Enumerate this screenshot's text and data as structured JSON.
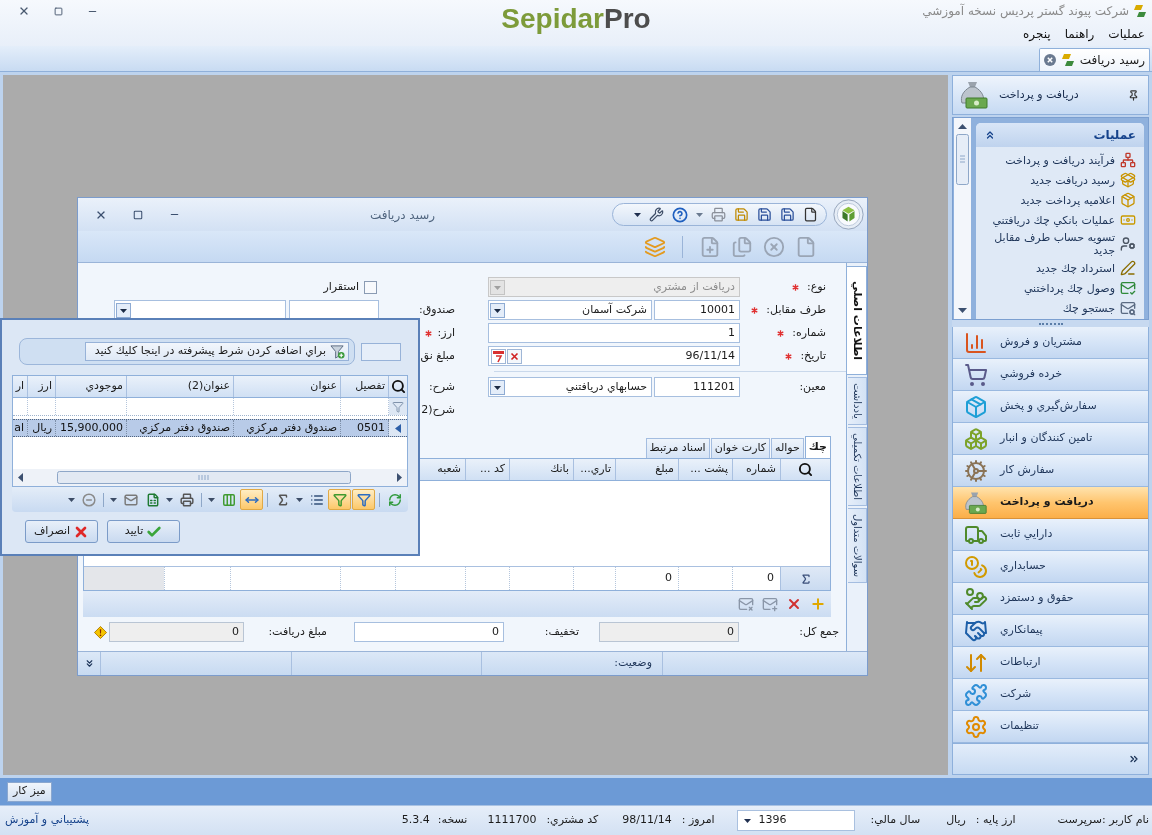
{
  "window": {
    "title": "شرکت پيوند گستر پرديس نسخه آموزشي",
    "logo": {
      "text_1": "Sepidar",
      "text_2": "Pro"
    }
  },
  "menu": [
    "عمليات",
    "راهنما",
    "پنجره"
  ],
  "document_tabs": [
    {
      "label": "رسيد دريافت",
      "selected": true
    }
  ],
  "sidebar": {
    "header": {
      "title": "دريافت و پرداخت"
    },
    "task_group": {
      "title": "عمليات",
      "expanded": true,
      "items": [
        "فرآيند دريافت و پرداخت",
        "رسيد دريافت جديد",
        "اعلاميه پرداخت جديد",
        "عمليات بانکي چك دريافتني",
        "تسويه حساب طرف مقابل جديد",
        "استرداد چك جديد",
        "وصول چك پرداختني",
        "جستجو چك"
      ]
    },
    "nav_items": [
      {
        "label": "مشتريان و فروش",
        "selected": false
      },
      {
        "label": "خرده فروشي",
        "selected": false
      },
      {
        "label": "سفارش‌گيري و پخش",
        "selected": false
      },
      {
        "label": "تامين کنندگان و انبار",
        "selected": false
      },
      {
        "label": "سفارش کار",
        "selected": false
      },
      {
        "label": "دريافت و پرداخت",
        "selected": true
      },
      {
        "label": "دارايي ثابت",
        "selected": false
      },
      {
        "label": "حسابداري",
        "selected": false
      },
      {
        "label": "حقوق و دستمزد",
        "selected": false
      },
      {
        "label": "پيمانکاري",
        "selected": false
      },
      {
        "label": "ارتباطات",
        "selected": false
      },
      {
        "label": "شرکت",
        "selected": false
      },
      {
        "label": "تنظيمات",
        "selected": false
      }
    ]
  },
  "receipt_window": {
    "title": "رسيد دريافت",
    "side_tabs": [
      {
        "label": "اطلاعات اصلي",
        "selected": true
      },
      {
        "label": "يادداشت",
        "selected": false
      },
      {
        "label": "اطلاعات تکميلي",
        "selected": false
      },
      {
        "label": "سوالات متداول",
        "selected": false
      }
    ],
    "fields": [
      {
        "kind": "combo",
        "label": "نوع:",
        "required": true,
        "disabled": true,
        "value": "دريافت از مشتري"
      },
      {
        "kind": "code_combo",
        "label": "طرف مقابل:",
        "required": true,
        "disabled": false,
        "code": "10001",
        "value": "شرکت آسمان"
      },
      {
        "kind": "text",
        "label": "شماره:",
        "required": true,
        "disabled": false,
        "value": "1"
      },
      {
        "kind": "date",
        "label": "تاريخ:",
        "required": true,
        "disabled": false,
        "value": "96/11/14"
      },
      {
        "kind": "code_combo",
        "label": "معين:",
        "required": false,
        "disabled": false,
        "code": "111201",
        "value": "حسابهاي دريافتني"
      }
    ],
    "side_fields": [
      {
        "kind": "checkbox",
        "label": "استقرار",
        "checked": false,
        "required": false
      },
      {
        "kind": "code_combo",
        "label": "صندوق:",
        "required": false
      },
      {
        "kind": "label",
        "label": "ارز:",
        "required": true
      },
      {
        "kind": "label",
        "label": "مبلغ نق",
        "required": false
      },
      {
        "kind": "label",
        "label": "شرح:",
        "required": false
      },
      {
        "kind": "label",
        "label": "شرح(2",
        "required": false
      }
    ],
    "detail_tabs": [
      {
        "label": "چك",
        "selected": true
      },
      {
        "label": "حواله",
        "selected": false
      },
      {
        "label": "کارت خوان",
        "selected": false
      },
      {
        "label": "اسناد مرتبط",
        "selected": false
      }
    ],
    "cheque_grid": {
      "columns": [
        {
          "label": "شماره",
          "total": "0"
        },
        {
          "label": "پشت ..."
        },
        {
          "label": "مبلغ",
          "total": "0"
        },
        {
          "label": "تاري..."
        },
        {
          "label": "بانك"
        },
        {
          "label": "کد ..."
        },
        {
          "label": "شعبه"
        }
      ]
    },
    "totals": [
      {
        "label": "جمع کل:",
        "value": "0",
        "readonly": true,
        "warning": false
      },
      {
        "label": "تخفيف:",
        "value": "0",
        "readonly": false,
        "warning": false
      },
      {
        "label": "مبلغ دريافت:",
        "value": "0",
        "readonly": true,
        "warning": true
      }
    ],
    "status_label": "وضعيت:"
  },
  "lookup_popup": {
    "filter_hint": "براي اضافه کردن شرط پيشرفته در اينجا کليك کنيد",
    "columns": [
      "تفصيل",
      "عنوان",
      "عنوان(2)",
      "موجودي",
      "ارز",
      "ار"
    ],
    "rows": [
      {
        "cells": [
          "0501",
          "صندوق دفتر مرکزي",
          "صندوق دفتر مرکزي",
          "15,900,000",
          "ريال",
          "al"
        ],
        "selected": true
      }
    ],
    "toolbar_buttons": [
      {
        "pressed": false
      },
      {
        "pressed": true
      },
      {
        "pressed": true
      },
      {
        "pressed": false
      },
      {
        "pressed": false
      },
      {
        "pressed": true
      },
      {
        "pressed": false
      },
      {
        "pressed": false
      },
      {
        "pressed": false
      },
      {
        "pressed": false
      },
      {
        "pressed": false
      }
    ],
    "buttons": [
      {
        "kind": "confirm",
        "label": "تاييد"
      },
      {
        "kind": "cancel",
        "label": "انصراف"
      }
    ]
  },
  "taskbar": {
    "buttons": [
      "ميز کار"
    ]
  },
  "status_bar": {
    "user": "نام کاربر :سرپرست",
    "base_currency": {
      "label": "ارز پايه :",
      "value": "ريال"
    },
    "fiscal_year": {
      "label": "سال مالي:",
      "value": "1396"
    },
    "today": {
      "label": "امروز :",
      "value": "98/11/14"
    },
    "customer_code": {
      "label": "کد مشتري:",
      "value": "1111700"
    },
    "version": {
      "label": "نسخه:",
      "value": "5.3.4"
    },
    "support_link": "پشتيباني و آموزش"
  }
}
